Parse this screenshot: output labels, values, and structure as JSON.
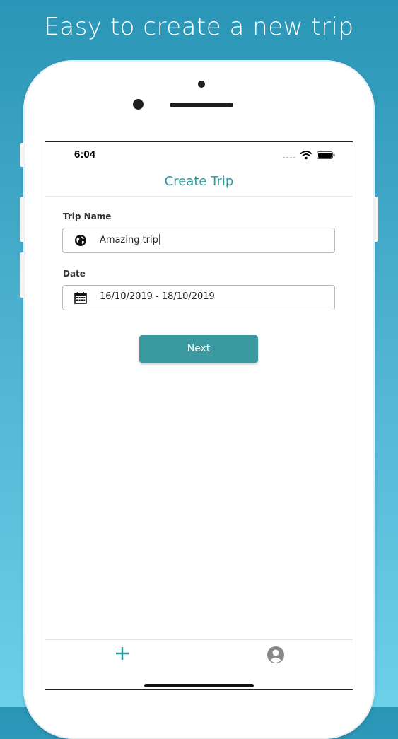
{
  "headline": "Easy to create a new trip",
  "status_bar": {
    "time": "6:04"
  },
  "nav": {
    "title": "Create Trip"
  },
  "form": {
    "trip_name": {
      "label": "Trip Name",
      "value": "Amazing trip",
      "icon": "globe-icon"
    },
    "date": {
      "label": "Date",
      "value": "16/10/2019 - 18/10/2019",
      "icon": "calendar-icon"
    },
    "next_label": "Next"
  },
  "tab_bar": {
    "items": [
      {
        "icon": "plus-icon"
      },
      {
        "icon": "user-icon"
      }
    ]
  },
  "colors": {
    "accent": "#3a9aa0",
    "title": "#2a9a9c",
    "background_top": "#2a95b6",
    "background_bottom": "#6dd0ea"
  }
}
